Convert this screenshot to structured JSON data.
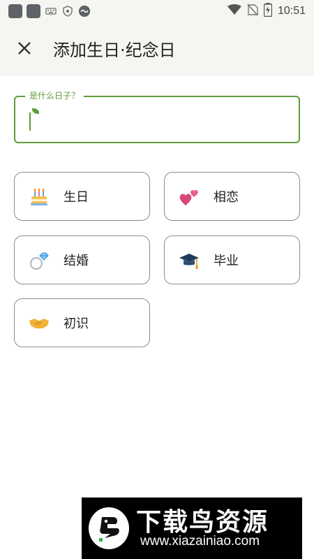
{
  "status_bar": {
    "time": "10:51",
    "icons": [
      "app-icon",
      "app-icon",
      "keyboard-icon",
      "shield-icon",
      "cloud-icon",
      "wifi-icon",
      "no-sim-icon",
      "battery-icon"
    ]
  },
  "app_bar": {
    "close_icon": "close-icon",
    "title": "添加生日·纪念日"
  },
  "input": {
    "label": "是什么日子？",
    "value": "",
    "accent_color": "#5f9b3b"
  },
  "chips": [
    {
      "icon": "birthday-cake-icon",
      "label": "生日"
    },
    {
      "icon": "two-hearts-icon",
      "label": "相恋"
    },
    {
      "icon": "ring-icon",
      "label": "结婚"
    },
    {
      "icon": "graduation-cap-icon",
      "label": "毕业"
    },
    {
      "icon": "handshake-icon",
      "label": "初识"
    }
  ],
  "watermark": {
    "title": "下载鸟资源",
    "url": "www.xiazainiao.com"
  }
}
